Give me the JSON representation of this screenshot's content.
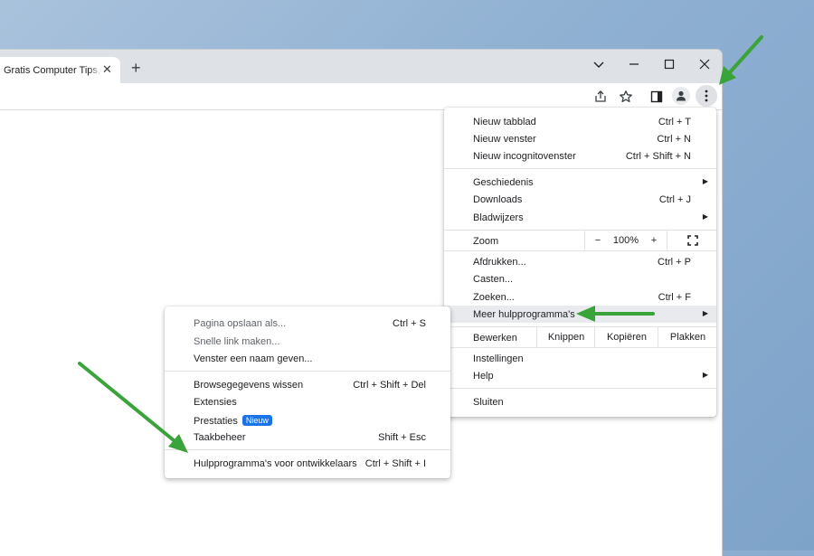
{
  "tab": {
    "title": "Gratis Computer Tips, h",
    "close": "✕"
  },
  "new_tab_symbol": "+",
  "main_menu": {
    "new_tab": {
      "label": "Nieuw tabblad",
      "shortcut": "Ctrl + T"
    },
    "new_window": {
      "label": "Nieuw venster",
      "shortcut": "Ctrl + N"
    },
    "incognito": {
      "label": "Nieuw incognitovenster",
      "shortcut": "Ctrl + Shift + N"
    },
    "history": {
      "label": "Geschiedenis"
    },
    "downloads": {
      "label": "Downloads",
      "shortcut": "Ctrl + J"
    },
    "bookmarks": {
      "label": "Bladwijzers"
    },
    "zoom": {
      "label": "Zoom",
      "minus": "−",
      "value": "100%",
      "plus": "+"
    },
    "print": {
      "label": "Afdrukken...",
      "shortcut": "Ctrl + P"
    },
    "cast": {
      "label": "Casten..."
    },
    "find": {
      "label": "Zoeken...",
      "shortcut": "Ctrl + F"
    },
    "more_tools": {
      "label": "Meer hulpprogramma's"
    },
    "edit": {
      "label": "Bewerken",
      "cut": "Knippen",
      "copy": "Kopiëren",
      "paste": "Plakken"
    },
    "settings": {
      "label": "Instellingen"
    },
    "help": {
      "label": "Help"
    },
    "exit": {
      "label": "Sluiten"
    }
  },
  "sub_menu": {
    "save_page": {
      "label": "Pagina opslaan als...",
      "shortcut": "Ctrl + S"
    },
    "quick_link": {
      "label": "Snelle link maken..."
    },
    "name_window": {
      "label": "Venster een naam geven..."
    },
    "clear_data": {
      "label": "Browsegegevens wissen",
      "shortcut": "Ctrl + Shift + Del"
    },
    "extensions": {
      "label": "Extensies"
    },
    "performance": {
      "label": "Prestaties",
      "badge": "Nieuw"
    },
    "task_manager": {
      "label": "Taakbeheer",
      "shortcut": "Shift + Esc"
    },
    "dev_tools": {
      "label": "Hulpprogramma's voor ontwikkelaars",
      "shortcut": "Ctrl + Shift + I"
    }
  },
  "colors": {
    "arrow": "#3aa33a",
    "badge": "#1a73e8",
    "highlight": "#e8eaed"
  }
}
